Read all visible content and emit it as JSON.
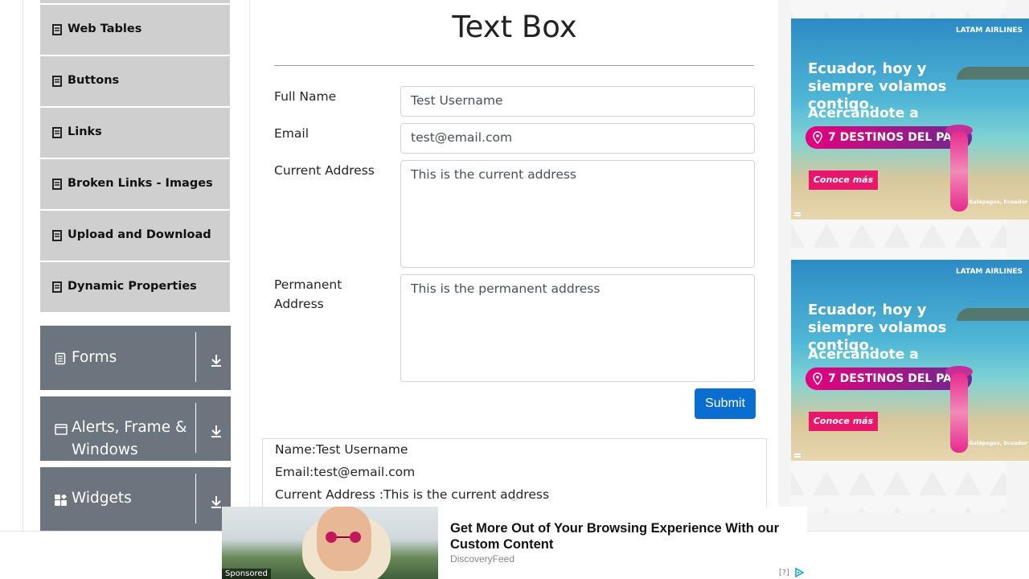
{
  "sidebar": {
    "elements": [
      {
        "label": "Web Tables"
      },
      {
        "label": "Buttons"
      },
      {
        "label": "Links"
      },
      {
        "label": "Broken Links - Images"
      },
      {
        "label": "Upload and Download"
      },
      {
        "label": "Dynamic Properties"
      }
    ],
    "groups": [
      {
        "label": "Forms",
        "icon": "form-doc-icon"
      },
      {
        "label": "Alerts, Frame & Windows",
        "icon": "window-icon"
      },
      {
        "label": "Widgets",
        "icon": "widgets-icon"
      }
    ]
  },
  "main": {
    "title": "Text Box",
    "form": {
      "full_name_label": "Full Name",
      "full_name_value": "Test Username",
      "email_label": "Email",
      "email_value": "test@email.com",
      "current_address_label": "Current Address",
      "current_address_value": "This is the current address",
      "permanent_address_label": "Permanent Address",
      "permanent_address_value": "This is the permanent address",
      "submit_label": "Submit"
    },
    "output": {
      "name": "Name:Test Username",
      "email": "Email:test@email.com",
      "current_address": "Current Address :This is the current address"
    }
  },
  "ads": {
    "brand": "LATAM AIRLINES",
    "headline": "Ecuador, hoy y siempre volamos contigo.",
    "subhead": "Acercándote a",
    "pill": "7 DESTINOS DEL PAÍS",
    "cta": "Conoce más",
    "location": "Galápagos, Ecuador"
  },
  "native_ad": {
    "headline": "Get More Out of Your Browsing Experience With our Custom Content",
    "source": "DiscoveryFeed",
    "sponsored": "Sponsored",
    "info": "[?]"
  },
  "colors": {
    "sidebar_item_bg": "#cfcfcf",
    "group_bg": "#6c757d",
    "submit_bg": "#0a6ed1",
    "ad_pill": "#e5007d"
  }
}
